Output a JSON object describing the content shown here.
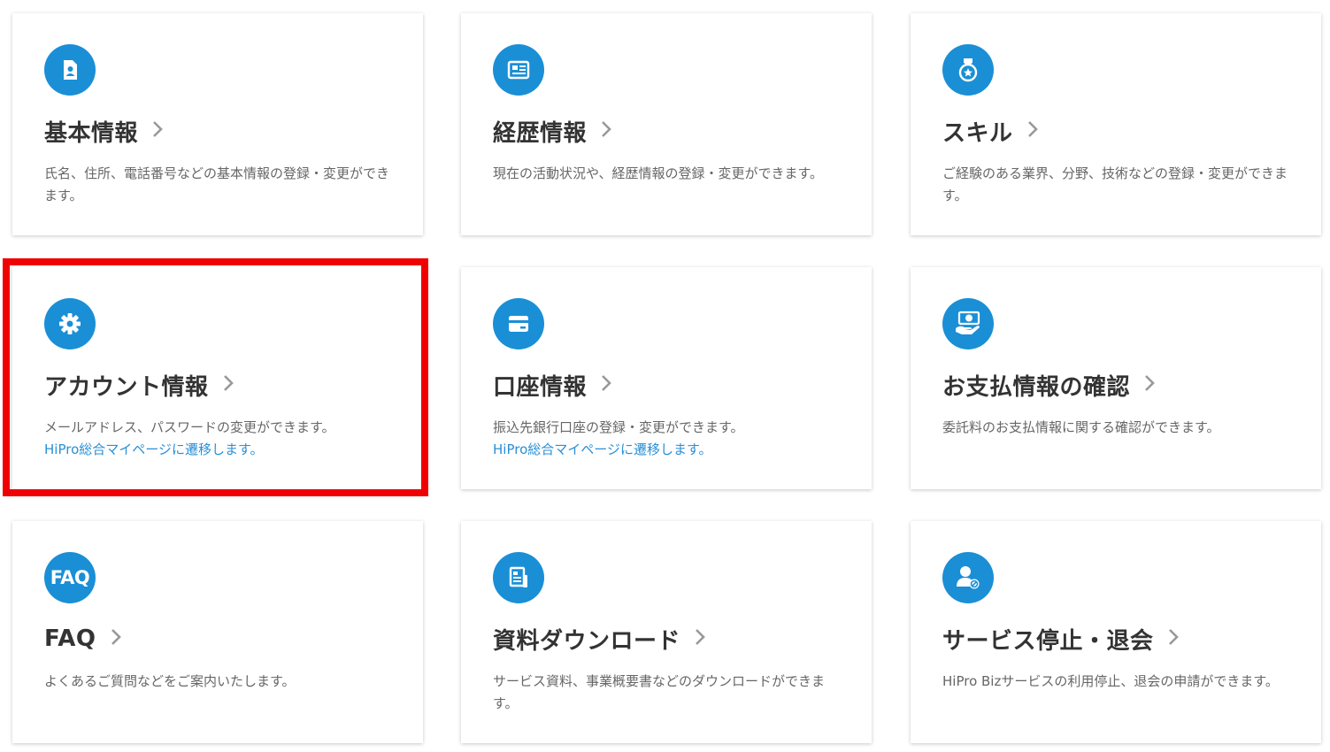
{
  "accent_color": "#1a8fd6",
  "link_color": "#2a8fd6",
  "highlight_color": "#f00000",
  "cards": [
    {
      "id": "basic-info",
      "icon": "profile-document-icon",
      "title": "基本情報",
      "description": "氏名、住所、電話番号などの基本情報の登録・変更ができます。",
      "link": ""
    },
    {
      "id": "career",
      "icon": "resume-icon",
      "title": "経歴情報",
      "description": "現在の活動状況や、経歴情報の登録・変更ができます。",
      "link": ""
    },
    {
      "id": "skills",
      "icon": "medal-icon",
      "title": "スキル",
      "description": "ご経験のある業界、分野、技術などの登録・変更ができます。",
      "link": ""
    },
    {
      "id": "account",
      "icon": "gear-icon",
      "title": "アカウント情報",
      "description": "メールアドレス、パスワードの変更ができます。",
      "link": "HiPro総合マイページに遷移します。"
    },
    {
      "id": "bank",
      "icon": "card-icon",
      "title": "口座情報",
      "description": "振込先銀行口座の登録・変更ができます。",
      "link": "HiPro総合マイページに遷移します。"
    },
    {
      "id": "payment",
      "icon": "yen-hand-icon",
      "title": "お支払情報の確認",
      "description": "委託料のお支払情報に関する確認ができます。",
      "link": ""
    },
    {
      "id": "faq",
      "icon": "faq-icon",
      "icon_text": "FAQ",
      "title": "FAQ",
      "description": "よくあるご質問などをご案内いたします。",
      "link": ""
    },
    {
      "id": "download",
      "icon": "document-download-icon",
      "title": "資料ダウンロード",
      "description": "サービス資料、事業概要書などのダウンロードができます。",
      "link": ""
    },
    {
      "id": "withdraw",
      "icon": "user-stop-icon",
      "title": "サービス停止・退会",
      "description": "HiPro Bizサービスの利用停止、退会の申請ができます。",
      "link": ""
    }
  ]
}
